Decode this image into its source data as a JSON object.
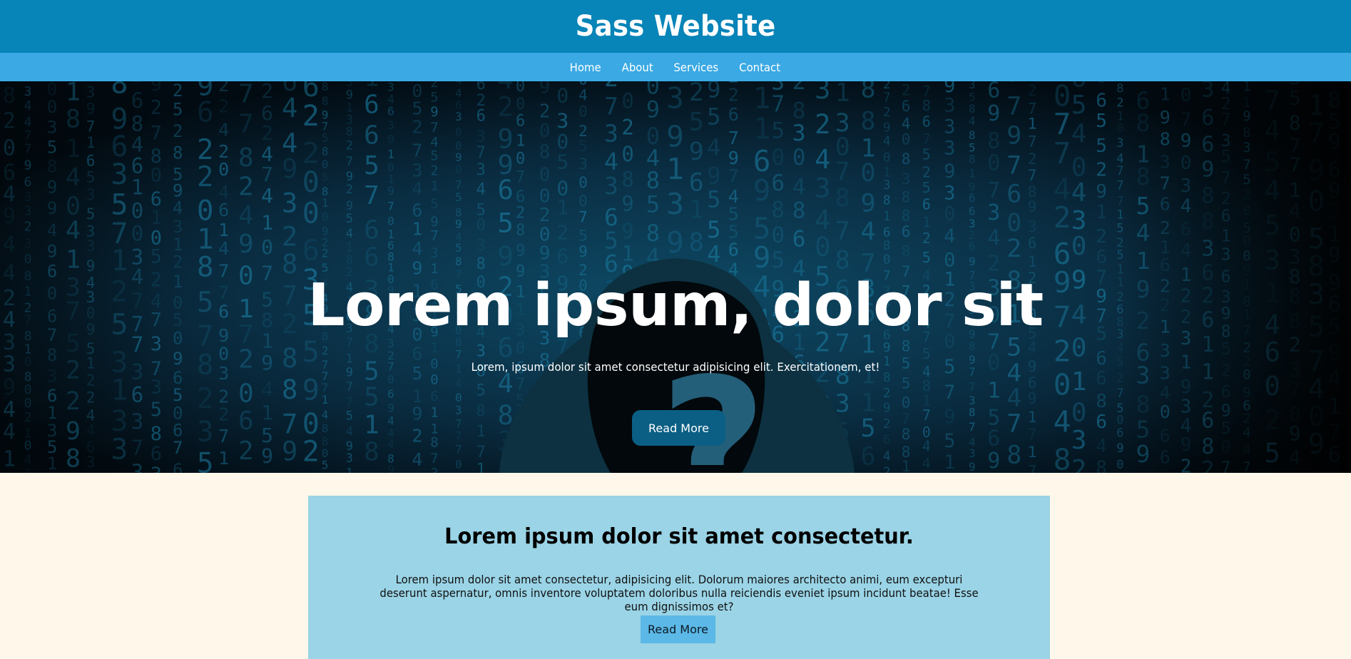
{
  "header": {
    "title": "Sass Website"
  },
  "nav": {
    "items": [
      {
        "label": "Home"
      },
      {
        "label": "About"
      },
      {
        "label": "Services"
      },
      {
        "label": "Contact"
      }
    ]
  },
  "hero": {
    "heading": "Lorem ipsum, dolor sit",
    "subtext": "Lorem, ipsum dolor sit amet consectetur adipisicing elit. Exercitationem, et!",
    "button_label": "Read More",
    "background_image": "hooded-figure-with-question-mark-on-digital-numbers",
    "overlay_glyph": "?"
  },
  "section": {
    "title": "Lorem ipsum dolor sit amet consectetur.",
    "text": "Lorem ipsum dolor sit amet consectetur, adipisicing elit. Dolorum maiores architecto animi, eum excepturi deserunt aspernatur, omnis inventore voluptatem doloribus nulla reiciendis eveniet ipsum incidunt beatae! Esse eum dignissimos et?",
    "button_label": "Read More"
  },
  "colors": {
    "header_bg": "#0784b8",
    "nav_bg": "#3aa9e4",
    "page_bg": "#fff8ea",
    "card_bg": "#9ad4e6",
    "hero_button_bg": "#0b5f84",
    "card_button_bg": "#5cb8e6"
  }
}
